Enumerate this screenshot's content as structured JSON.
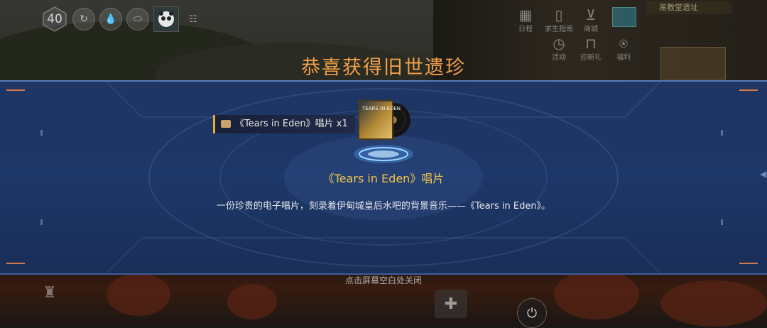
{
  "hud": {
    "level": "40",
    "map_address": "黑教堂遗址",
    "buttons": [
      {
        "label": "日程",
        "icon": "calendar-icon"
      },
      {
        "label": "求生指南",
        "icon": "book-icon"
      },
      {
        "label": "商城",
        "icon": "cart-icon"
      },
      {
        "label": "活动",
        "icon": "clock-icon"
      },
      {
        "label": "迎新礼",
        "icon": "gift-bag-icon"
      },
      {
        "label": "福利",
        "icon": "welfare-icon"
      }
    ]
  },
  "modal": {
    "title": "恭喜获得旧世遗珍",
    "reward_chip": "《Tears in Eden》唱片 x1",
    "item_name": "《Tears in Eden》唱片",
    "item_description": "一份珍贵的电子唱片，刻录着伊甸城皇后水吧的背景音乐——《Tears in Eden》。",
    "record_cover_text": "TEARS IN EDEN",
    "close_hint": "点击屏幕空白处关闭"
  },
  "colors": {
    "title": "#f0a04a",
    "item_name": "#f0c24a",
    "banner": "#1d3768",
    "chip_accent": "#e0b12b"
  }
}
